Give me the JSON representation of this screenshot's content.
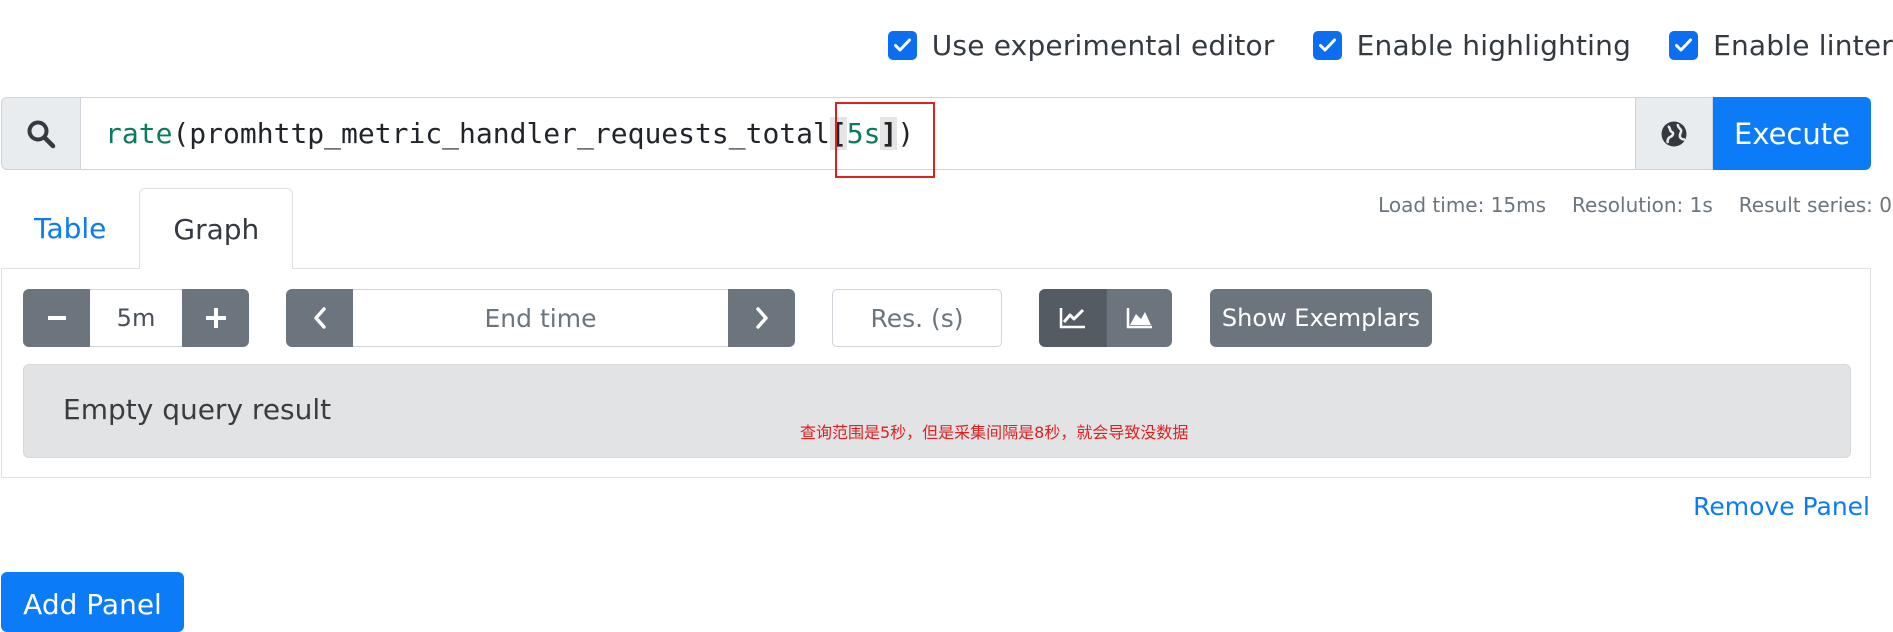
{
  "options": [
    {
      "label": "Use experimental editor",
      "checked": true
    },
    {
      "label": "Enable highlighting",
      "checked": true
    },
    {
      "label": "Enable linter",
      "checked": true
    }
  ],
  "expression": {
    "fn": "rate",
    "open_paren": "(",
    "metric": "promhttp_metric_handler_requests_total",
    "open_bracket": "[",
    "range": "5s",
    "close_bracket": "]",
    "close_paren": ")"
  },
  "execute_label": "Execute",
  "stats": {
    "load_time": "Load time: 15ms",
    "resolution": "Resolution: 1s",
    "result_series": "Result series: 0"
  },
  "tabs": [
    {
      "label": "Table",
      "active": false
    },
    {
      "label": "Graph",
      "active": true
    }
  ],
  "controls": {
    "range_value": "5m",
    "end_time_placeholder": "End time",
    "resolution_placeholder": "Res. (s)",
    "exemplars_label": "Show Exemplars"
  },
  "result": {
    "message": "Empty query result",
    "annotation": "查询范围是5秒，但是采集间隔是8秒，就会导致没数据"
  },
  "remove_panel_label": "Remove Panel",
  "add_panel_label": "Add Panel",
  "colors": {
    "primary": "#0b7bf8",
    "secondary": "#6c757d",
    "annotation_red": "#e02020"
  }
}
